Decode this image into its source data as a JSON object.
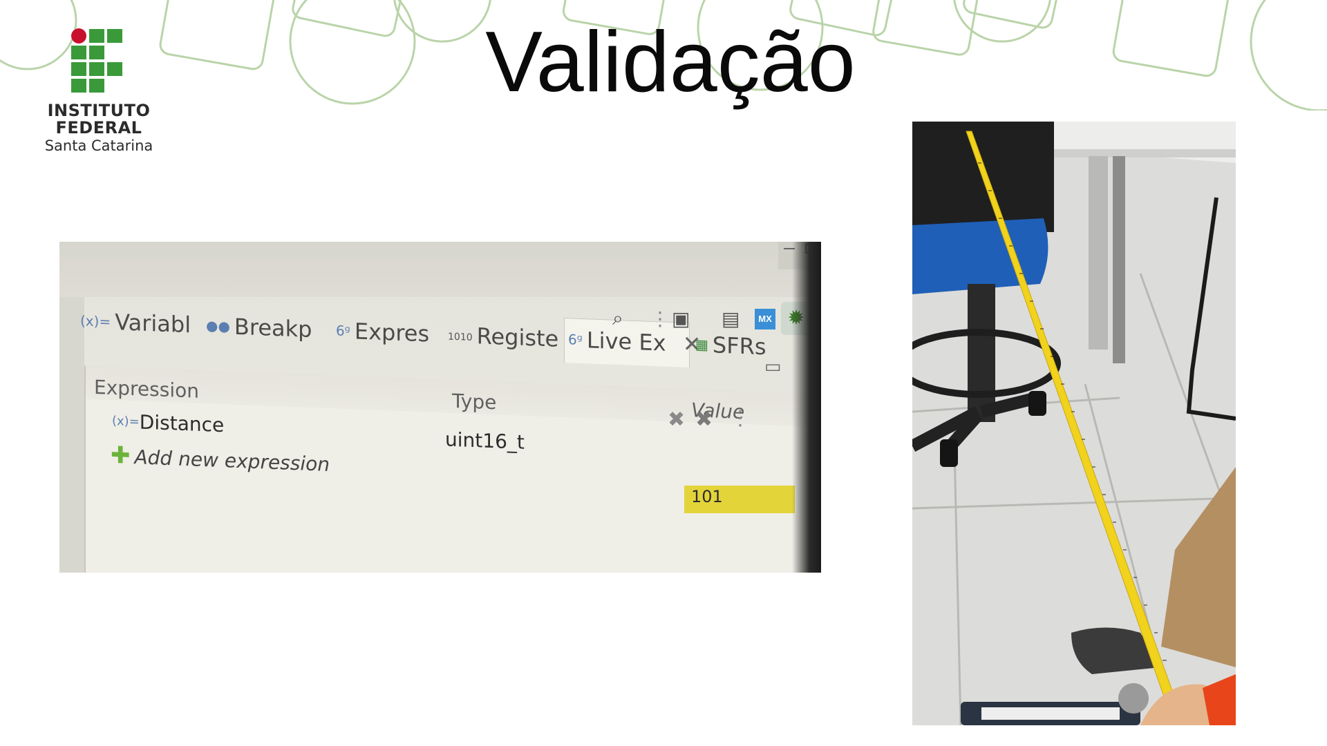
{
  "slide": {
    "title": "Validação"
  },
  "logo": {
    "line1": "INSTITUTO",
    "line2": "FEDERAL",
    "line3": "Santa Catarina",
    "colors": {
      "green": "#3a9a3a",
      "red": "#c8102e"
    }
  },
  "ide": {
    "tabs": [
      {
        "label": "Variabl",
        "icon": "variables-icon"
      },
      {
        "label": "Breakp",
        "icon": "breakpoints-icon"
      },
      {
        "label": "Expres",
        "icon": "expressions-icon"
      },
      {
        "label": "Registe",
        "icon": "registers-icon"
      },
      {
        "label": "Live Ex",
        "icon": "live-expressions-icon",
        "active": true
      },
      {
        "label": "SFRs",
        "icon": "sfrs-icon"
      }
    ],
    "columns": {
      "expression": "Expression",
      "type": "Type",
      "value": "Value"
    },
    "rows": [
      {
        "expression": "Distance",
        "type": "uint16_t",
        "value": "101"
      }
    ],
    "add_expression": "Add new expression",
    "highlight_color": "#e3d43a"
  }
}
